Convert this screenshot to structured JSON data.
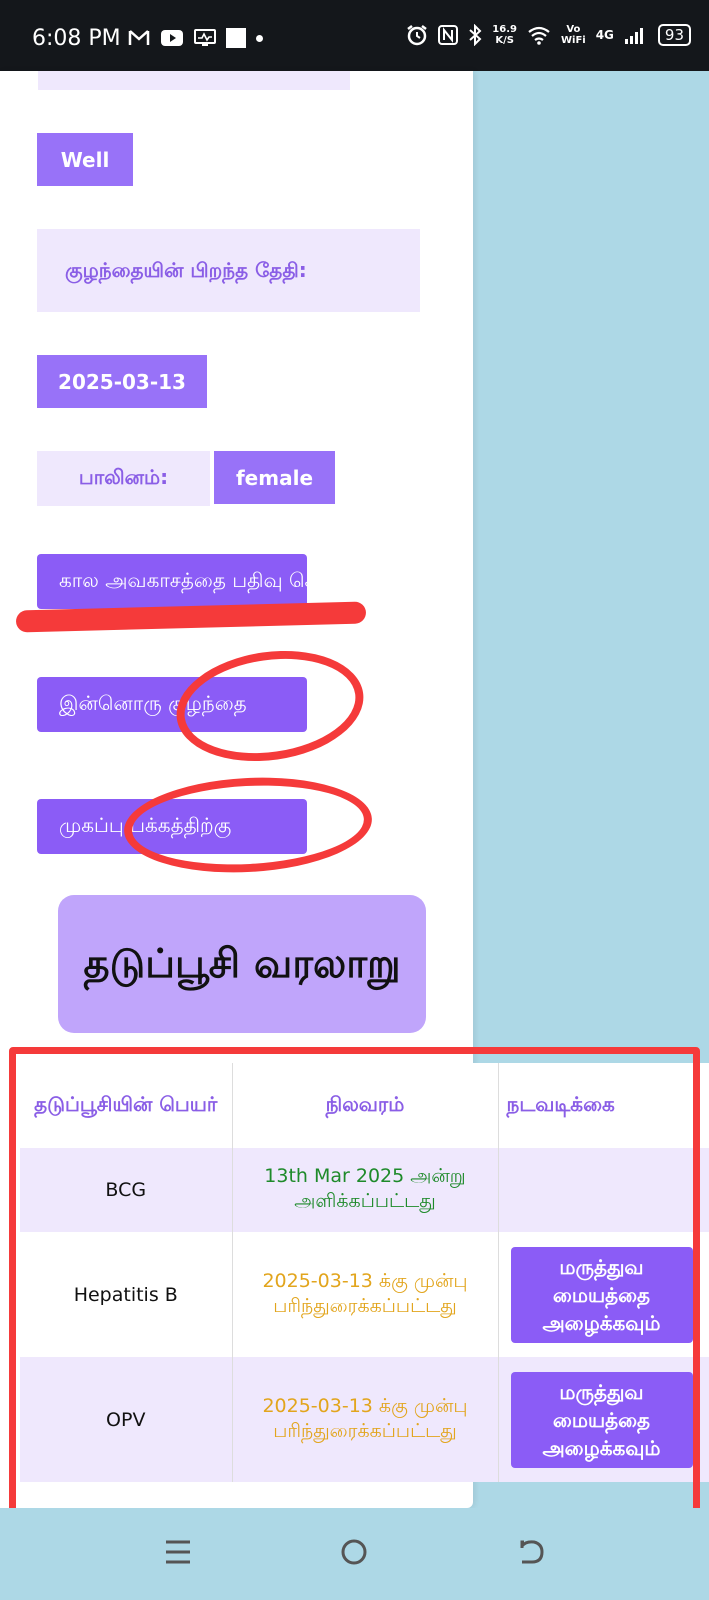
{
  "status_bar": {
    "time": "6:08 PM",
    "left_icons": [
      "gmail-icon",
      "youtube-icon",
      "monitor-icon",
      "square-icon",
      "dot-icon"
    ],
    "right_icons": [
      "alarm-icon",
      "nfc-icon",
      "bluetooth-icon",
      "wifi-icon",
      "signal-icon"
    ],
    "net_speed_value": "16.9",
    "net_speed_unit": "K/S",
    "vowifi_top": "Vo",
    "vowifi_bottom": "WiFi",
    "network": "4G",
    "battery": "93"
  },
  "form": {
    "condition_value": "Well",
    "dob_label": "குழந்தையின் பிறந்த தேதி:",
    "dob_value": "2025-03-13",
    "gender_label": "பாலினம்:",
    "gender_value": "female",
    "btn_schedule": "கால அவகாசத்தை பதிவு செய்",
    "btn_add_child": "இன்னொரு குழந்தை",
    "btn_home": "முகப்பு பக்கத்திற்கு"
  },
  "heading": "தடுப்பூசி வரலாறு",
  "table": {
    "headers": [
      "தடுப்பூசியின் பெயர்",
      "நிலவரம்",
      "நடவடிக்கை"
    ],
    "rows": [
      {
        "name": "BCG",
        "status": "13th Mar 2025 அன்று அளிக்கப்பட்டது",
        "action": ""
      },
      {
        "name": "Hepatitis B",
        "status": "2025-03-13 க்கு முன்பு பரிந்துரைக்கப்பட்டது",
        "action": "மருத்துவ மையத்தை அழைக்கவும்"
      },
      {
        "name": "OPV",
        "status": "2025-03-13 க்கு முன்பு பரிந்துரைக்கப்பட்டது",
        "action": "மருத்துவ மையத்தை அழைக்கவும்"
      }
    ]
  },
  "colors": {
    "accent": "#8b5cf6",
    "given": "#1e8a2a",
    "due": "#e2a51d",
    "highlight": "#f53a3a",
    "background": "#add8e6"
  }
}
